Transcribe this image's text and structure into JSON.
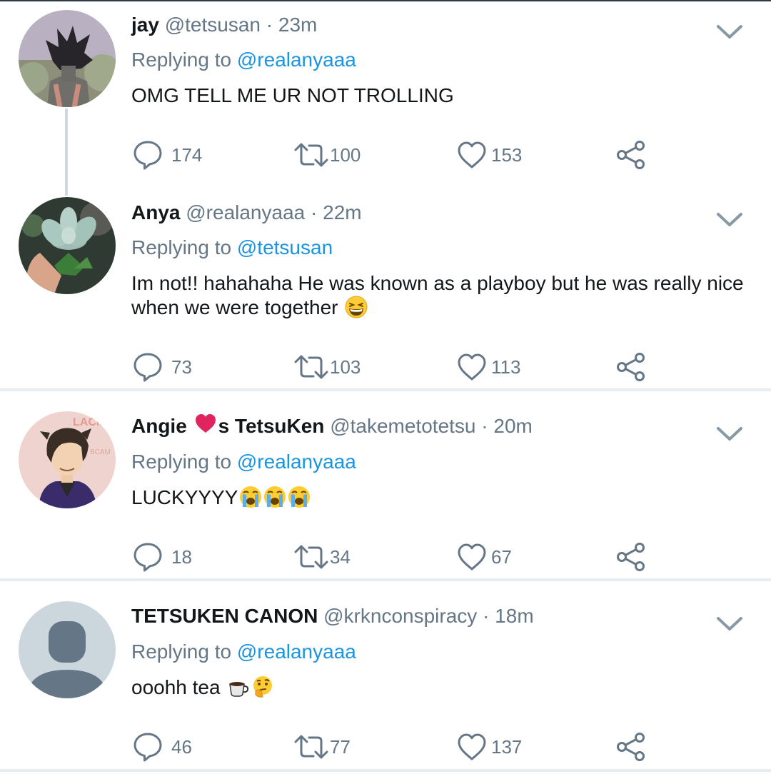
{
  "tweets": [
    {
      "name": "jay",
      "handle": "@tetsusan",
      "separator": "·",
      "time": "23m",
      "replying_prefix": "Replying to",
      "replying_to": "@realanyaaa",
      "text": "OMG TELL ME UR NOT TROLLING",
      "replies": "174",
      "retweets": "100",
      "likes": "153"
    },
    {
      "name": "Anya",
      "handle": "@realanyaaa",
      "separator": "·",
      "time": "22m",
      "replying_prefix": "Replying to",
      "replying_to": "@tetsusan",
      "text": "Im not!! hahahaha He was known as a playboy but he was really nice when we were together",
      "emojis": [
        "grinning-squint-emoji"
      ],
      "replies": "73",
      "retweets": "103",
      "likes": "113"
    },
    {
      "name_part1": "Angie ",
      "name_part2": "s TetsuKen",
      "handle": "@takemetotetsu",
      "separator": "·",
      "time": "20m",
      "replying_prefix": "Replying to",
      "replying_to": "@realanyaaa",
      "text": "LUCKYYYY",
      "emojis": [
        "loudly-crying-emoji",
        "loudly-crying-emoji",
        "loudly-crying-emoji"
      ],
      "replies": "18",
      "retweets": "34",
      "likes": "67"
    },
    {
      "name": "TETSUKEN CANON",
      "handle": "@krknconspiracy",
      "separator": "·",
      "time": "18m",
      "replying_prefix": "Replying to",
      "replying_to": "@realanyaaa",
      "text": "ooohh tea",
      "emojis": [
        "hot-beverage-emoji",
        "thinking-face-emoji"
      ],
      "replies": "46",
      "retweets": "77",
      "likes": "137"
    }
  ],
  "colors": {
    "text": "#14171a",
    "secondary": "#657786",
    "link": "#1b95e0",
    "divider": "#e6ecf0",
    "heart": "#e0245e"
  }
}
